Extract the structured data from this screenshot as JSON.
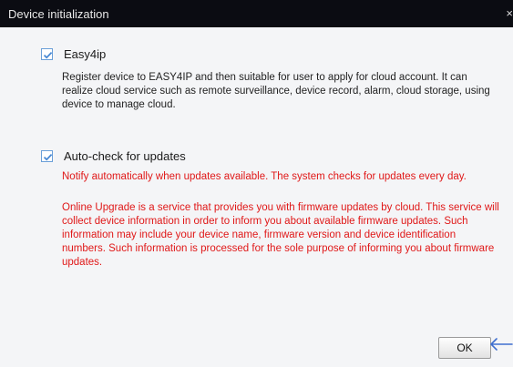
{
  "window": {
    "title": "Device initialization",
    "close_glyph": "×"
  },
  "options": {
    "easy4ip": {
      "checked": true,
      "label": "Easy4ip",
      "description": "Register device to EASY4IP and then suitable for user to apply for cloud account. It can realize cloud service such as remote surveillance, device record, alarm, cloud storage, using device to manage cloud."
    },
    "auto_check": {
      "checked": true,
      "label": "Auto-check for updates",
      "notice": "Notify automatically when updates available. The system checks for updates every day.",
      "privacy_text": "Online Upgrade is a service that provides you with firmware updates by cloud. This service will collect device information in order to inform you about available firmware updates. Such information may include your device name, firmware version and device identification numbers. Such information is processed for the sole purpose of informing you about firmware updates."
    }
  },
  "footer": {
    "ok_label": "OK"
  },
  "colors": {
    "titlebar": "#0b0c12",
    "warning_text": "#e01818",
    "checkbox_accent": "#4a8ad4",
    "annotation_arrow": "#3f6fcf"
  },
  "icons": {
    "check": "check-icon",
    "close": "close-icon",
    "annotation": "arrow-left-icon"
  }
}
